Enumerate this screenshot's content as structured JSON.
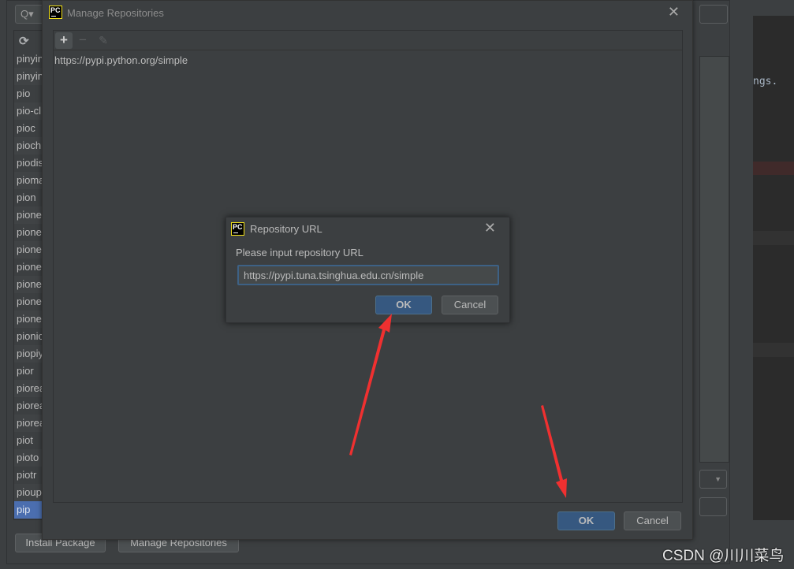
{
  "background": {
    "editor_text": "ngs."
  },
  "packages_dialog": {
    "search_icon": "search-icon",
    "refresh_icon": "refresh-icon",
    "items": [
      "pinyin",
      "pinyin",
      "pio",
      "pio-cl",
      "pioc",
      "piochr",
      "piodis",
      "pioma",
      "pion",
      "pione",
      "pione",
      "pione",
      "pione",
      "pione",
      "pione",
      "pione",
      "pionic",
      "piopiy",
      "pior",
      "piorea",
      "piorea",
      "piorea",
      "piot",
      "pioto",
      "piotr",
      "pioup",
      "pip"
    ],
    "selected": "pip",
    "install_label": "Install Package",
    "manage_label": "Manage Repositories"
  },
  "manage_repositories": {
    "title": "Manage Repositories",
    "toolbar": {
      "add": "+",
      "remove": "−",
      "edit": "✎"
    },
    "repositories": [
      "https://pypi.python.org/simple"
    ],
    "ok_label": "OK",
    "cancel_label": "Cancel"
  },
  "repository_url_dialog": {
    "title": "Repository URL",
    "prompt": "Please input repository URL",
    "value": "https://pypi.tuna.tsinghua.edu.cn/simple",
    "ok_label": "OK",
    "cancel_label": "Cancel"
  },
  "annotation_color": "#f03030",
  "watermark": "CSDN @川川菜鸟"
}
